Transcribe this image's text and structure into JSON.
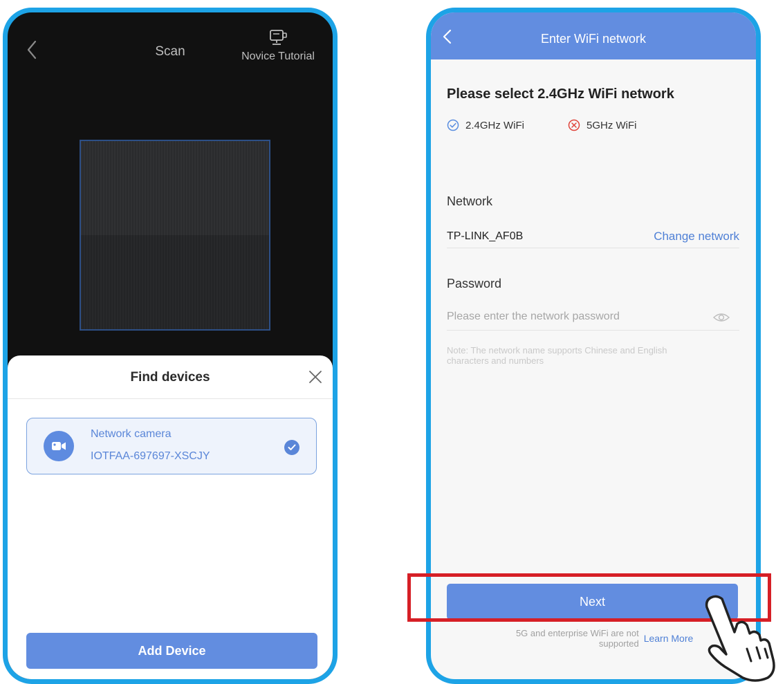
{
  "scan_screen": {
    "title": "Scan",
    "tutorial_label": "Novice Tutorial",
    "sheet": {
      "title": "Find devices",
      "device": {
        "name": "Network camera",
        "id": "IOTFAA-697697-XSCJY",
        "selected": true
      },
      "add_button_label": "Add Device"
    }
  },
  "wifi_screen": {
    "title": "Enter WiFi network",
    "heading": "Please select 2.4GHz WiFi network",
    "wifi_supported_label": "2.4GHz WiFi",
    "wifi_unsupported_label": "5GHz WiFi",
    "network_label": "Network",
    "network_value": "TP-LINK_AF0B",
    "change_network_label": "Change network",
    "password_label": "Password",
    "password_placeholder": "Please enter the network password",
    "note": "Note: The network name supports Chinese and English characters and numbers",
    "next_button_label": "Next",
    "footer_note": "5G and enterprise WiFi are not supported",
    "learn_more_label": "Learn More"
  },
  "colors": {
    "phone_border": "#1da3e6",
    "primary": "#628de0",
    "link": "#4f80d6",
    "supported_icon": "#5a8ee0",
    "unsupported_icon": "#e0453c",
    "highlight": "#d61f26"
  },
  "icons": {
    "back": "chevron-left-icon",
    "tutorial": "monitor-icon",
    "close": "close-icon",
    "camera": "video-camera-icon",
    "check": "check-circle-icon",
    "supported": "check-circle-outline-icon",
    "unsupported": "x-circle-outline-icon",
    "eye": "eye-icon",
    "hand": "tap-hand-icon"
  }
}
